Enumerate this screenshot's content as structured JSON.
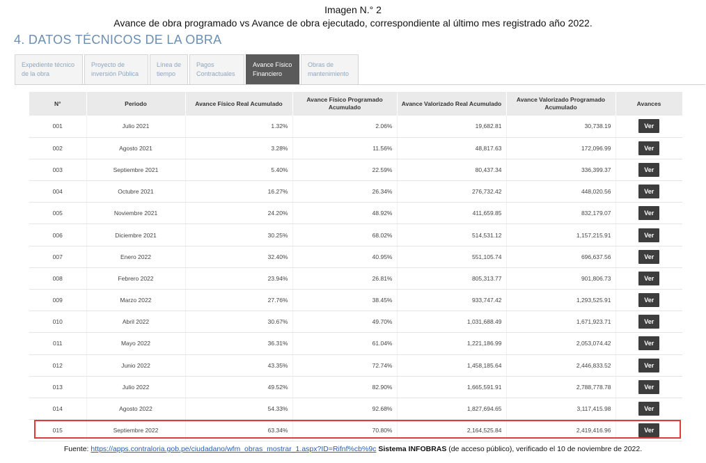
{
  "caption": {
    "line1": "Imagen N.° 2",
    "line2": "Avance de obra programado vs Avance de obra ejecutado, correspondiente al último mes registrado año 2022."
  },
  "section_title": "4. DATOS TÉCNICOS DE LA OBRA",
  "tabs": [
    {
      "line1": "Expediente técnico",
      "line2": "de la obra"
    },
    {
      "line1": "Proyecto de",
      "line2": "inversión Pública"
    },
    {
      "line1": "Línea de",
      "line2": "tiempo"
    },
    {
      "line1": "Pagos",
      "line2": "Contractuales"
    },
    {
      "line1": "Avance Físico",
      "line2": "Financiero"
    },
    {
      "line1": "Obras de",
      "line2": "mantenimiento"
    }
  ],
  "table": {
    "headers": [
      "N°",
      "Periodo",
      "Avance Físico Real Acumulado",
      "Avance Físico Programado Acumulado",
      "Avance Valorizado Real Acumulado",
      "Avance Valorizado Programado Acumulado",
      "Avances"
    ],
    "button_label": "Ver",
    "rows": [
      [
        "001",
        "Julio 2021",
        "1.32%",
        "2.06%",
        "19,682.81",
        "30,738.19"
      ],
      [
        "002",
        "Agosto 2021",
        "3.28%",
        "11.56%",
        "48,817.63",
        "172,096.99"
      ],
      [
        "003",
        "Septiembre 2021",
        "5.40%",
        "22.59%",
        "80,437.34",
        "336,399.37"
      ],
      [
        "004",
        "Octubre 2021",
        "16.27%",
        "26.34%",
        "276,732.42",
        "448,020.56"
      ],
      [
        "005",
        "Noviembre 2021",
        "24.20%",
        "48.92%",
        "411,659.85",
        "832,179.07"
      ],
      [
        "006",
        "Diciembre 2021",
        "30.25%",
        "68.02%",
        "514,531.12",
        "1,157,215.91"
      ],
      [
        "007",
        "Enero 2022",
        "32.40%",
        "40.95%",
        "551,105.74",
        "696,637.56"
      ],
      [
        "008",
        "Febrero 2022",
        "23.94%",
        "26.81%",
        "805,313.77",
        "901,806.73"
      ],
      [
        "009",
        "Marzo 2022",
        "27.76%",
        "38.45%",
        "933,747.42",
        "1,293,525.91"
      ],
      [
        "010",
        "Abril 2022",
        "30.67%",
        "49.70%",
        "1,031,688.49",
        "1,671,923.71"
      ],
      [
        "011",
        "Mayo 2022",
        "36.31%",
        "61.04%",
        "1,221,186.99",
        "2,053,074.42"
      ],
      [
        "012",
        "Junio 2022",
        "43.35%",
        "72.74%",
        "1,458,185.64",
        "2,446,833.52"
      ],
      [
        "013",
        "Julio 2022",
        "49.52%",
        "82.90%",
        "1,665,591.91",
        "2,788,778.78"
      ],
      [
        "014",
        "Agosto 2022",
        "54.33%",
        "92.68%",
        "1,827,694.65",
        "3,117,415.98"
      ],
      [
        "015",
        "Septiembre 2022",
        "63.34%",
        "70.80%",
        "2,164,525.84",
        "2,419,416.96"
      ]
    ]
  },
  "footer": {
    "prefix": "Fuente: ",
    "link": "https://apps.contraloria.gob.pe/ciudadano/wfm_obras_mostrar_1.aspx?ID=Rifnf%cb%9c",
    "bold": " Sistema INFOBRAS",
    "suffix": " (de acceso público), verificado el 10 de noviembre de 2022."
  }
}
